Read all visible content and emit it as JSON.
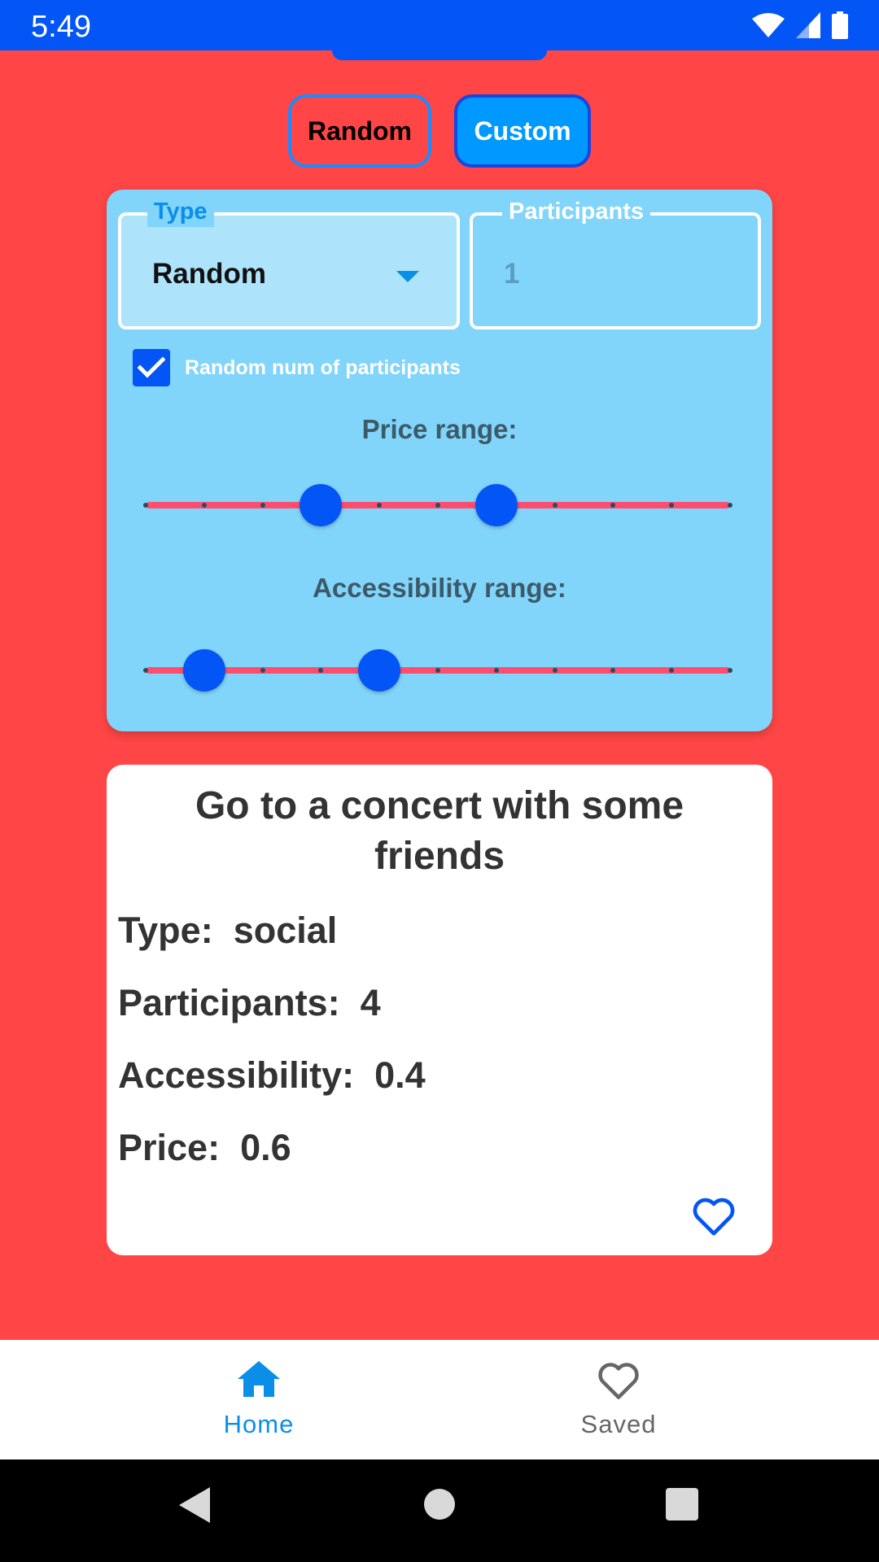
{
  "status_bar": {
    "time": "5:49"
  },
  "mode_buttons": {
    "random_label": "Random",
    "custom_label": "Custom",
    "selected": "Custom"
  },
  "filters": {
    "type_legend": "Type",
    "type_value": "Random",
    "participants_legend": "Participants",
    "participants_value": "1",
    "random_participants_label": "Random num of participants",
    "random_participants_checked": true,
    "price_range_title": "Price range:",
    "price_range": {
      "min": 0,
      "max": 1,
      "step": 0.1,
      "low": 0.3,
      "high": 0.6
    },
    "accessibility_range_title": "Accessibility range:",
    "accessibility_range": {
      "min": 0,
      "max": 1,
      "step": 0.1,
      "low": 0.1,
      "high": 0.4
    }
  },
  "activity": {
    "title": "Go to a concert with some friends",
    "type_label": "Type:",
    "type_value": "social",
    "participants_label": "Participants:",
    "participants_value": "4",
    "accessibility_label": "Accessibility:",
    "accessibility_value": "0.4",
    "price_label": "Price:",
    "price_value": "0.6",
    "save_icon": "heart-outline-icon"
  },
  "bottom_nav": {
    "items": [
      {
        "label": "Home",
        "icon": "home-icon",
        "active": true
      },
      {
        "label": "Saved",
        "icon": "heart-outline-icon",
        "active": false
      }
    ]
  },
  "colors": {
    "background": "#ff4545",
    "status_bar": "#0356f5",
    "accent_blue": "#0356f5",
    "card_blue": "#81d4fa",
    "slider_track": "#ff4d6d",
    "active_nav": "#0a8ee8"
  }
}
